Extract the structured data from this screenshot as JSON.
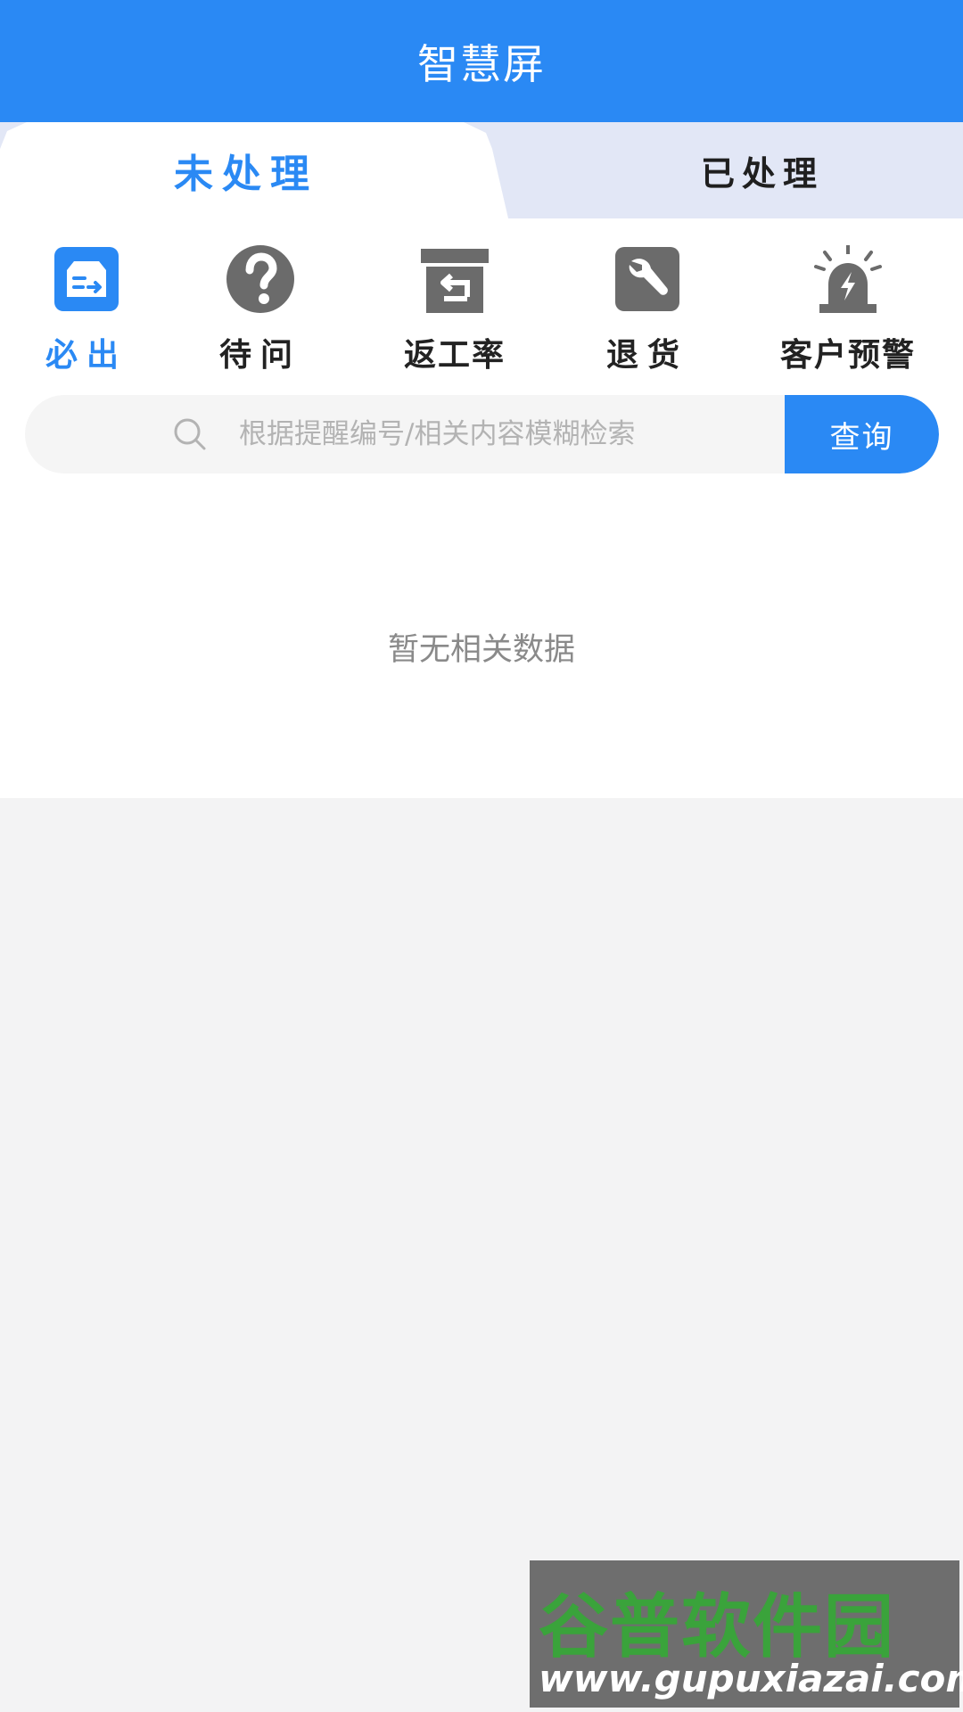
{
  "header": {
    "title": "智慧屏"
  },
  "tabs": [
    {
      "label": "未处理",
      "active": true
    },
    {
      "label": "已处理",
      "active": false
    }
  ],
  "categories": [
    {
      "label": "必出",
      "icon": "box-transfer-icon",
      "active": true
    },
    {
      "label": "待问",
      "icon": "question-icon",
      "active": false
    },
    {
      "label": "返工率",
      "icon": "return-box-icon",
      "active": false
    },
    {
      "label": "退货",
      "icon": "wrench-icon",
      "active": false
    },
    {
      "label": "客户预警",
      "icon": "alarm-light-icon",
      "active": false
    }
  ],
  "search": {
    "placeholder": "根据提醒编号/相关内容模糊检索",
    "value": "",
    "button_label": "查询"
  },
  "empty_state": {
    "text": "暂无相关数据"
  },
  "watermark": {
    "title": "谷普软件园",
    "url": "www.gupuxiazai.com"
  },
  "colors": {
    "accent": "#2a89f4",
    "icon_gray": "#6b6b6b",
    "tab_inactive_bg": "#e2e7f6",
    "page_bg": "#f3f3f4"
  }
}
